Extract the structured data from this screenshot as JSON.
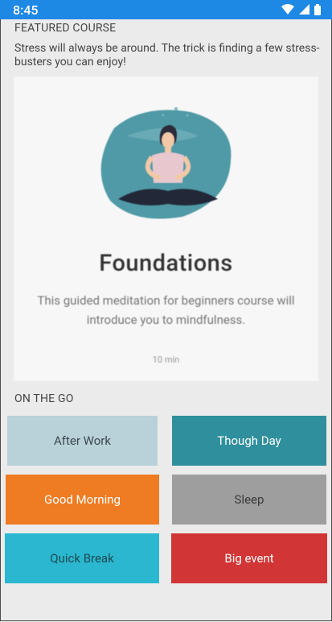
{
  "status_bar": {
    "time": "8:45",
    "icons": [
      "wifi-icon",
      "signal-icon",
      "battery-icon"
    ]
  },
  "featured": {
    "label": "FEATURED COURSE",
    "intro": "Stress will always be around. The trick is finding a few stress-busters you can enjoy!",
    "course": {
      "title": "Foundations",
      "description": "This guided meditation for beginners course will introduce you to mindfulness.",
      "duration": "10 min"
    }
  },
  "on_the_go": {
    "label": "ON THE GO",
    "tiles": [
      {
        "label": "After Work",
        "bg": "#b9d1d8",
        "fg": "#3b4a50"
      },
      {
        "label": "Though Day",
        "bg": "#2f8f9d",
        "fg": "#ffffff"
      },
      {
        "label": "Good Morning",
        "bg": "#ef7b22",
        "fg": "#ffffff"
      },
      {
        "label": "Sleep",
        "bg": "#9e9e9e",
        "fg": "#3a3a3a"
      },
      {
        "label": "Quick Break",
        "bg": "#2ab7cf",
        "fg": "#1f4b55"
      },
      {
        "label": "Big event",
        "bg": "#d23535",
        "fg": "#ffffff"
      }
    ]
  }
}
